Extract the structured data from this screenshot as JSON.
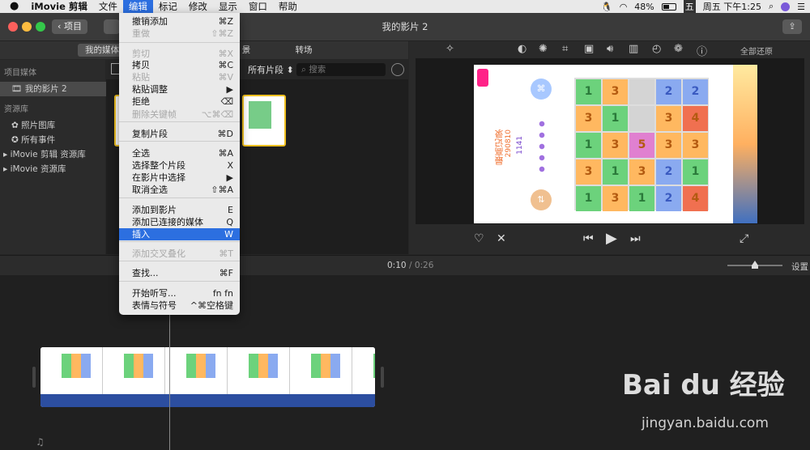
{
  "menubar": {
    "app_name": "iMovie 剪辑",
    "menus": [
      "文件",
      "编辑",
      "标记",
      "修改",
      "显示",
      "窗口",
      "帮助"
    ],
    "active_menu": "编辑",
    "status": {
      "battery": "48%",
      "ime": "五",
      "clock": "周五 下午1:25"
    }
  },
  "window": {
    "title": "我的影片 2",
    "back_label": "项目"
  },
  "browser_tabs": {
    "media": "我的媒体",
    "audio_partial": "景",
    "transitions": "转场"
  },
  "sidebar": {
    "project_media_header": "项目媒体",
    "project_item": "我的影片 2",
    "library_header": "资源库",
    "photos": "照片图库",
    "all_events": "所有事件",
    "imovie_edit_library": "iMovie 剪辑 资源库",
    "imovie_library": "iMovie 资源库"
  },
  "browser": {
    "clip_filter": "所有片段",
    "search_placeholder": "搜索"
  },
  "viewer": {
    "reset_all": "全部还原"
  },
  "timeline": {
    "current_time": "0:10",
    "separator": "/",
    "duration": "0:26",
    "settings": "设置"
  },
  "edit_menu": {
    "items": [
      {
        "label": "撤销添加",
        "shortcut": "⌘Z",
        "enabled": true
      },
      {
        "label": "重做",
        "shortcut": "⇧⌘Z",
        "enabled": false
      },
      {
        "label": "剪切",
        "shortcut": "⌘X",
        "enabled": false
      },
      {
        "label": "拷贝",
        "shortcut": "⌘C",
        "enabled": true
      },
      {
        "label": "粘贴",
        "shortcut": "⌘V",
        "enabled": false
      },
      {
        "label": "粘贴调整",
        "shortcut": "▶",
        "enabled": true
      },
      {
        "label": "拒绝",
        "shortcut": "⌫",
        "enabled": true
      },
      {
        "label": "删除关键帧",
        "shortcut": "⌥⌘⌫",
        "enabled": false
      },
      {
        "label": "复制片段",
        "shortcut": "⌘D",
        "enabled": true
      },
      {
        "label": "全选",
        "shortcut": "⌘A",
        "enabled": true
      },
      {
        "label": "选择整个片段",
        "shortcut": "X",
        "enabled": true
      },
      {
        "label": "在影片中选择",
        "shortcut": "▶",
        "enabled": true
      },
      {
        "label": "取消全选",
        "shortcut": "⇧⌘A",
        "enabled": true
      },
      {
        "label": "添加到影片",
        "shortcut": "E",
        "enabled": true
      },
      {
        "label": "添加已连接的媒体",
        "shortcut": "Q",
        "enabled": true
      },
      {
        "label": "插入",
        "shortcut": "W",
        "enabled": true,
        "highlighted": true
      },
      {
        "label": "添加交叉叠化",
        "shortcut": "⌘T",
        "enabled": false
      },
      {
        "label": "查找...",
        "shortcut": "⌘F",
        "enabled": true
      },
      {
        "label": "开始听写...",
        "shortcut": "fn fn",
        "enabled": true
      },
      {
        "label": "表情与符号",
        "shortcut": "^⌘空格键",
        "enabled": true
      }
    ]
  },
  "game_preview": {
    "best_label": "最高记录",
    "best_score": "290810",
    "current_score": "1141",
    "grid": [
      [
        "1",
        "3",
        "",
        "2",
        "2"
      ],
      [
        "3",
        "1",
        "",
        "3",
        "4"
      ],
      [
        "1",
        "3",
        "5",
        "3",
        "3"
      ],
      [
        "3",
        "1",
        "3",
        "2",
        "1"
      ],
      [
        "1",
        "3",
        "1",
        "2",
        "4"
      ]
    ]
  },
  "watermark": {
    "logo": "Bai du 经验",
    "url": "jingyan.baidu.com"
  },
  "colors": {
    "menu_highlight": "#2c6fe0",
    "audio_track": "#2c4ea0",
    "clip_selected": "#f0c020"
  }
}
